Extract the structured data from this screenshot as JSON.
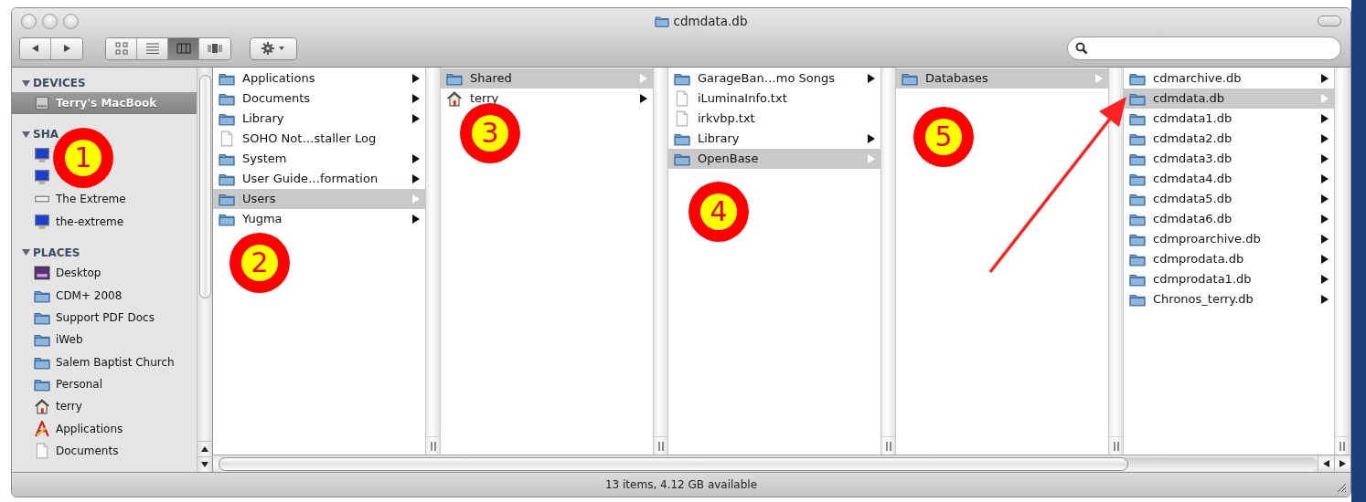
{
  "window": {
    "title": "cdmdata.db"
  },
  "toolbar": {
    "views": [
      {
        "kind": "icon",
        "selected": false
      },
      {
        "kind": "list",
        "selected": false
      },
      {
        "kind": "column",
        "selected": true
      },
      {
        "kind": "coverflow",
        "selected": false
      }
    ]
  },
  "sidebar": {
    "sections": [
      {
        "header": "DEVICES",
        "expanded": true,
        "items": [
          {
            "label": "Terry's MacBook",
            "kind": "hard-drive",
            "selected": true
          }
        ]
      },
      {
        "header": "SHA",
        "expanded": true,
        "items": [
          {
            "kind": "monitor",
            "selected": false
          },
          {
            "kind": "monitor",
            "selected": false
          },
          {
            "label": "The Extreme",
            "kind": "drive",
            "selected": false
          },
          {
            "label": "the-extreme",
            "kind": "monitor",
            "selected": false
          }
        ]
      },
      {
        "header": "PLACES",
        "expanded": true,
        "items": [
          {
            "label": "Desktop",
            "kind": "desktop",
            "selected": false
          },
          {
            "label": "CDM+ 2008",
            "kind": "folder",
            "selected": false
          },
          {
            "label": "Support PDF Docs",
            "kind": "folder",
            "selected": false
          },
          {
            "label": "iWeb",
            "kind": "folder",
            "selected": false
          },
          {
            "label": "Salem Baptist Church",
            "kind": "folder",
            "selected": false
          },
          {
            "label": "Personal",
            "kind": "folder",
            "selected": false
          },
          {
            "label": "terry",
            "kind": "home",
            "selected": false
          },
          {
            "label": "Applications",
            "kind": "applications",
            "selected": false
          },
          {
            "label": "Documents",
            "kind": "document",
            "selected": false
          }
        ]
      }
    ]
  },
  "columns": [
    {
      "items": [
        {
          "label": "Applications",
          "kind": "folder",
          "expandable": true,
          "selected": false
        },
        {
          "label": "Documents",
          "kind": "folder",
          "expandable": true,
          "selected": false
        },
        {
          "label": "Library",
          "kind": "folder",
          "expandable": true,
          "selected": false
        },
        {
          "label": "SOHO Not…staller Log",
          "kind": "document",
          "expandable": false,
          "selected": false
        },
        {
          "label": "System",
          "kind": "folder",
          "expandable": true,
          "selected": false
        },
        {
          "label": "User Guide…formation",
          "kind": "folder",
          "expandable": true,
          "selected": false
        },
        {
          "label": "Users",
          "kind": "folder",
          "expandable": true,
          "selected": true
        },
        {
          "label": "Yugma",
          "kind": "folder",
          "expandable": true,
          "selected": false
        }
      ]
    },
    {
      "items": [
        {
          "label": "Shared",
          "kind": "folder",
          "expandable": true,
          "selected": true
        },
        {
          "label": "terry",
          "kind": "home",
          "expandable": true,
          "selected": false
        }
      ]
    },
    {
      "items": [
        {
          "label": "GarageBan…mo Songs",
          "kind": "folder",
          "expandable": true,
          "selected": false
        },
        {
          "label": "iLuminaInfo.txt",
          "kind": "document",
          "expandable": false,
          "selected": false
        },
        {
          "label": "irkvbp.txt",
          "kind": "document",
          "expandable": false,
          "selected": false
        },
        {
          "label": "Library",
          "kind": "folder",
          "expandable": true,
          "selected": false
        },
        {
          "label": "OpenBase",
          "kind": "folder",
          "expandable": true,
          "selected": true
        }
      ]
    },
    {
      "items": [
        {
          "label": "Databases",
          "kind": "folder",
          "expandable": true,
          "selected": true
        }
      ]
    },
    {
      "items": [
        {
          "label": "cdmarchive.db",
          "kind": "folder",
          "expandable": true,
          "selected": false
        },
        {
          "label": "cdmdata.db",
          "kind": "folder",
          "expandable": true,
          "selected": true
        },
        {
          "label": "cdmdata1.db",
          "kind": "folder",
          "expandable": true,
          "selected": false
        },
        {
          "label": "cdmdata2.db",
          "kind": "folder",
          "expandable": true,
          "selected": false
        },
        {
          "label": "cdmdata3.db",
          "kind": "folder",
          "expandable": true,
          "selected": false
        },
        {
          "label": "cdmdata4.db",
          "kind": "folder",
          "expandable": true,
          "selected": false
        },
        {
          "label": "cdmdata5.db",
          "kind": "folder",
          "expandable": true,
          "selected": false
        },
        {
          "label": "cdmdata6.db",
          "kind": "folder",
          "expandable": true,
          "selected": false
        },
        {
          "label": "cdmproarchive.db",
          "kind": "folder",
          "expandable": true,
          "selected": false
        },
        {
          "label": "cdmprodata.db",
          "kind": "folder",
          "expandable": true,
          "selected": false
        },
        {
          "label": "cdmprodata1.db",
          "kind": "folder",
          "expandable": true,
          "selected": false
        },
        {
          "label": "Chronos_terry.db",
          "kind": "folder",
          "expandable": true,
          "selected": false
        }
      ]
    }
  ],
  "status_bar": "13 items, 4.12 GB available",
  "callouts": [
    {
      "number": "1"
    },
    {
      "number": "2"
    },
    {
      "number": "3"
    },
    {
      "number": "4"
    },
    {
      "number": "5"
    }
  ]
}
